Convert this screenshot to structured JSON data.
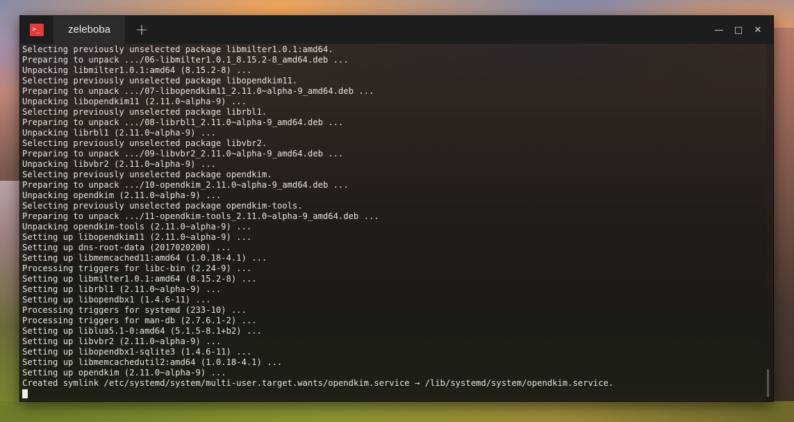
{
  "window": {
    "tab_title": "zeleboba",
    "new_tab_glyph": "+",
    "app_icon_glyph": ">_",
    "controls": {
      "minimize": "—",
      "maximize": "□",
      "close": "✕"
    }
  },
  "terminal": {
    "lines": [
      "Selecting previously unselected package libmilter1.0.1:amd64.",
      "Preparing to unpack .../06-libmilter1.0.1_8.15.2-8_amd64.deb ...",
      "Unpacking libmilter1.0.1:amd64 (8.15.2-8) ...",
      "Selecting previously unselected package libopendkim11.",
      "Preparing to unpack .../07-libopendkim11_2.11.0~alpha-9_amd64.deb ...",
      "Unpacking libopendkim11 (2.11.0~alpha-9) ...",
      "Selecting previously unselected package librbl1.",
      "Preparing to unpack .../08-librbl1_2.11.0~alpha-9_amd64.deb ...",
      "Unpacking librbl1 (2.11.0~alpha-9) ...",
      "Selecting previously unselected package libvbr2.",
      "Preparing to unpack .../09-libvbr2_2.11.0~alpha-9_amd64.deb ...",
      "Unpacking libvbr2 (2.11.0~alpha-9) ...",
      "Selecting previously unselected package opendkim.",
      "Preparing to unpack .../10-opendkim_2.11.0~alpha-9_amd64.deb ...",
      "Unpacking opendkim (2.11.0~alpha-9) ...",
      "Selecting previously unselected package opendkim-tools.",
      "Preparing to unpack .../11-opendkim-tools_2.11.0~alpha-9_amd64.deb ...",
      "Unpacking opendkim-tools (2.11.0~alpha-9) ...",
      "Setting up libopendkim11 (2.11.0~alpha-9) ...",
      "Setting up dns-root-data (2017020200) ...",
      "Setting up libmemcached11:amd64 (1.0.18-4.1) ...",
      "Processing triggers for libc-bin (2.24-9) ...",
      "Setting up libmilter1.0.1:amd64 (8.15.2-8) ...",
      "Setting up librbl1 (2.11.0~alpha-9) ...",
      "Setting up libopendbx1 (1.4.6-11) ...",
      "Processing triggers for systemd (233-10) ...",
      "Processing triggers for man-db (2.7.6.1-2) ...",
      "Setting up liblua5.1-0:amd64 (5.1.5-8.1+b2) ...",
      "Setting up libvbr2 (2.11.0~alpha-9) ...",
      "Setting up libopendbx1-sqlite3 (1.4.6-11) ...",
      "Setting up libmemcachedutil2:amd64 (1.0.18-4.1) ...",
      "Setting up opendkim (2.11.0~alpha-9) ...",
      "Created symlink /etc/systemd/system/multi-user.target.wants/opendkim.service → /lib/systemd/system/opendkim.service."
    ]
  },
  "colors": {
    "accent": "#e23b3b",
    "terminal_bg": "#181614",
    "terminal_fg": "#e4e4e4"
  }
}
